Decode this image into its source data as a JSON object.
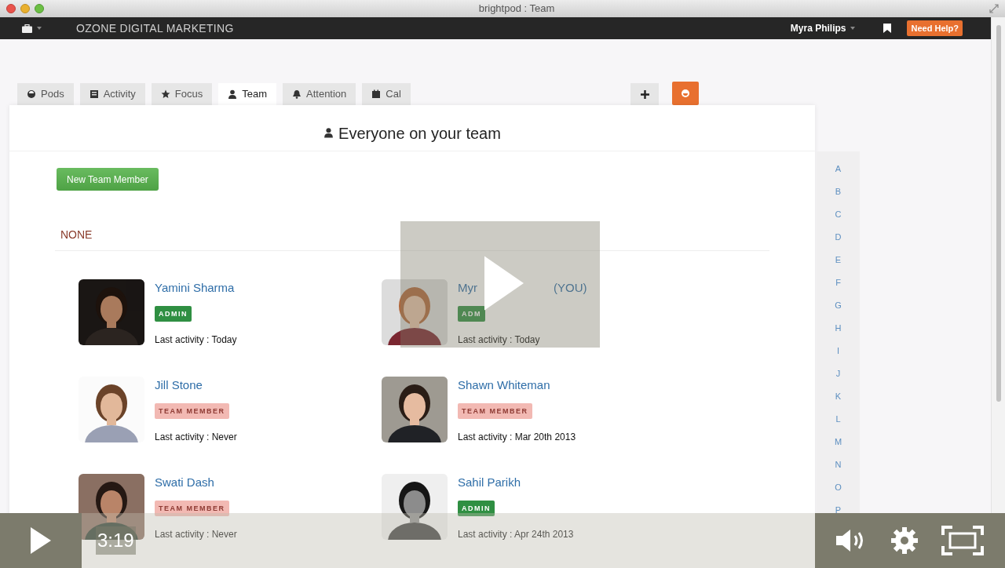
{
  "window": {
    "title": "brightpod : Team"
  },
  "navbar": {
    "workspace": "OZONE DIGITAL MARKETING",
    "user": "Myra Philips",
    "help_button": "Need Help?"
  },
  "tabs": [
    {
      "label": "Pods",
      "selected": false
    },
    {
      "label": "Activity",
      "selected": false
    },
    {
      "label": "Focus",
      "selected": false
    },
    {
      "label": "Team",
      "selected": true
    },
    {
      "label": "Attention",
      "selected": false
    },
    {
      "label": "Cal",
      "selected": false
    }
  ],
  "page": {
    "heading": "Everyone on your team",
    "new_button": "New Team Member",
    "group": "NONE"
  },
  "members": [
    {
      "name": "Yamini Sharma",
      "role": "ADMIN",
      "kind": "admin",
      "activity": "Last activity : Today"
    },
    {
      "name": "Myr",
      "name_suffix": "(YOU)",
      "role": "ADM",
      "kind": "admin",
      "activity": "Last activity : Today"
    },
    {
      "name": "Jill Stone",
      "role": "TEAM MEMBER",
      "kind": "member",
      "activity": "Last activity : Never"
    },
    {
      "name": "Shawn Whiteman",
      "role": "TEAM MEMBER",
      "kind": "member",
      "activity": "Last activity : Mar 20th 2013"
    },
    {
      "name": "Swati Dash",
      "role": "TEAM MEMBER",
      "kind": "member",
      "activity": "Last activity : Never"
    },
    {
      "name": "Sahil Parikh",
      "role": "ADMIN",
      "kind": "admin",
      "activity": "Last activity : Apr 24th 2013"
    }
  ],
  "alphabet": [
    "A",
    "B",
    "C",
    "D",
    "E",
    "F",
    "G",
    "H",
    "I",
    "J",
    "K",
    "L",
    "M",
    "N",
    "O",
    "P"
  ],
  "player": {
    "time": "3:19"
  }
}
